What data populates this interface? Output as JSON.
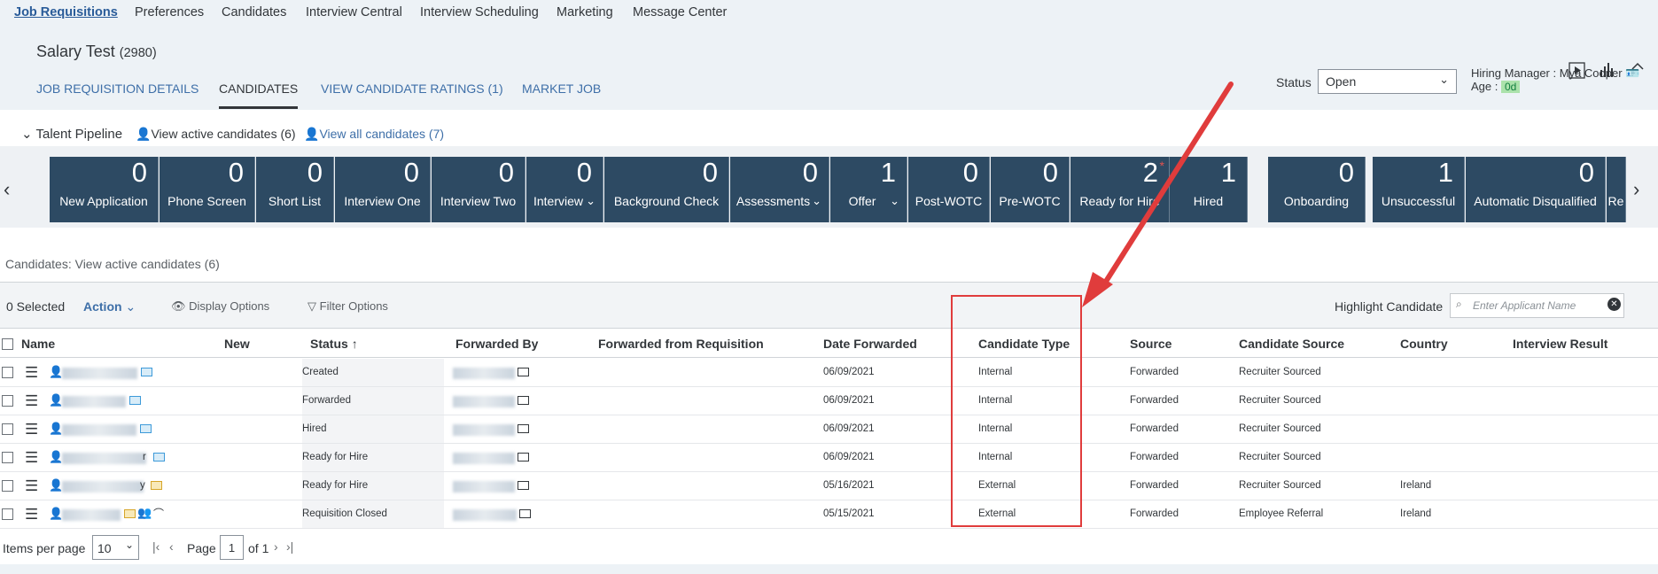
{
  "top_nav": [
    "Job Requisitions",
    "Preferences",
    "Candidates",
    "Interview Central",
    "Interview Scheduling",
    "Marketing",
    "Message Center"
  ],
  "header": {
    "title": "Salary Test",
    "count": "(2980)",
    "tabs": [
      "JOB REQUISITION DETAILS",
      "CANDIDATES",
      "VIEW CANDIDATE RATINGS (1)",
      "MARKET JOB"
    ],
    "status_label": "Status",
    "status_value": "Open",
    "hiring_manager_label": "Hiring Manager :",
    "hiring_manager_name": "Mya Cooper",
    "age_label": "Age :",
    "age_value": "0d"
  },
  "pipeline": {
    "title": "Talent Pipeline",
    "view_active": "View active candidates (6)",
    "view_all": "View all candidates (7)",
    "stages": [
      {
        "count": "0",
        "label": "New Application",
        "dropdown": false
      },
      {
        "count": "0",
        "label": "Phone Screen",
        "dropdown": false
      },
      {
        "count": "0",
        "label": "Short List",
        "dropdown": false
      },
      {
        "count": "0",
        "label": "Interview One",
        "dropdown": false
      },
      {
        "count": "0",
        "label": "Interview Two",
        "dropdown": false
      },
      {
        "count": "0",
        "label": "Interview",
        "dropdown": true
      },
      {
        "count": "0",
        "label": "Background Check",
        "dropdown": false
      },
      {
        "count": "0",
        "label": "Assessments",
        "dropdown": true
      },
      {
        "count": "1",
        "label": "Offer",
        "dropdown": true
      },
      {
        "count": "0",
        "label": "Post-WOTC",
        "dropdown": false
      },
      {
        "count": "0",
        "label": "Pre-WOTC",
        "dropdown": false
      },
      {
        "count": "2",
        "label": "Ready for Hire",
        "dropdown": false,
        "flagged": true
      },
      {
        "count": "1",
        "label": "Hired",
        "dropdown": false
      },
      {
        "count": "0",
        "label": "Onboarding",
        "dropdown": false
      },
      {
        "count": "1",
        "label": "Unsuccessful",
        "dropdown": false
      },
      {
        "count": "0",
        "label": "Automatic Disqualified",
        "dropdown": false
      },
      {
        "count": "",
        "label": "Re",
        "dropdown": false
      }
    ]
  },
  "candidates_header": "Candidates: View active candidates (6)",
  "toolbar": {
    "selected": "0 Selected",
    "action": "Action",
    "display_options": "Display Options",
    "filter_options": "Filter Options",
    "highlight_label": "Highlight Candidate",
    "highlight_placeholder": "Enter Applicant Name"
  },
  "table": {
    "columns": [
      "Name",
      "New",
      "Status",
      "Forwarded By",
      "Forwarded from Requisition",
      "Date Forwarded",
      "Candidate Type",
      "Source",
      "Candidate Source",
      "Country",
      "Interview Result"
    ],
    "rows": [
      {
        "status": "Created",
        "date": "06/09/2021",
        "type": "Internal",
        "source": "Forwarded",
        "cand_source": "Recruiter Sourced",
        "country": "",
        "name_suffix": ""
      },
      {
        "status": "Forwarded",
        "date": "06/09/2021",
        "type": "Internal",
        "source": "Forwarded",
        "cand_source": "Recruiter Sourced",
        "country": "",
        "name_suffix": ""
      },
      {
        "status": "Hired",
        "date": "06/09/2021",
        "type": "Internal",
        "source": "Forwarded",
        "cand_source": "Recruiter Sourced",
        "country": "",
        "name_suffix": ""
      },
      {
        "status": "Ready for Hire",
        "date": "06/09/2021",
        "type": "Internal",
        "source": "Forwarded",
        "cand_source": "Recruiter Sourced",
        "country": "",
        "name_suffix": "r"
      },
      {
        "status": "Ready for Hire",
        "date": "05/16/2021",
        "type": "External",
        "source": "Forwarded",
        "cand_source": "Recruiter Sourced",
        "country": "Ireland",
        "name_suffix": "y"
      },
      {
        "status": "Requisition Closed",
        "date": "05/15/2021",
        "type": "External",
        "source": "Forwarded",
        "cand_source": "Employee Referral",
        "country": "Ireland",
        "name_suffix": ""
      }
    ]
  },
  "footer": {
    "items_per_page_label": "Items per page",
    "items_per_page_value": "10",
    "page_label": "Page",
    "page_value": "1",
    "of_label": "of 1"
  },
  "colors": {
    "stage_bg": "#2d4a63",
    "annotation_red": "#e03c3c",
    "link_blue": "#3e6fa8"
  }
}
